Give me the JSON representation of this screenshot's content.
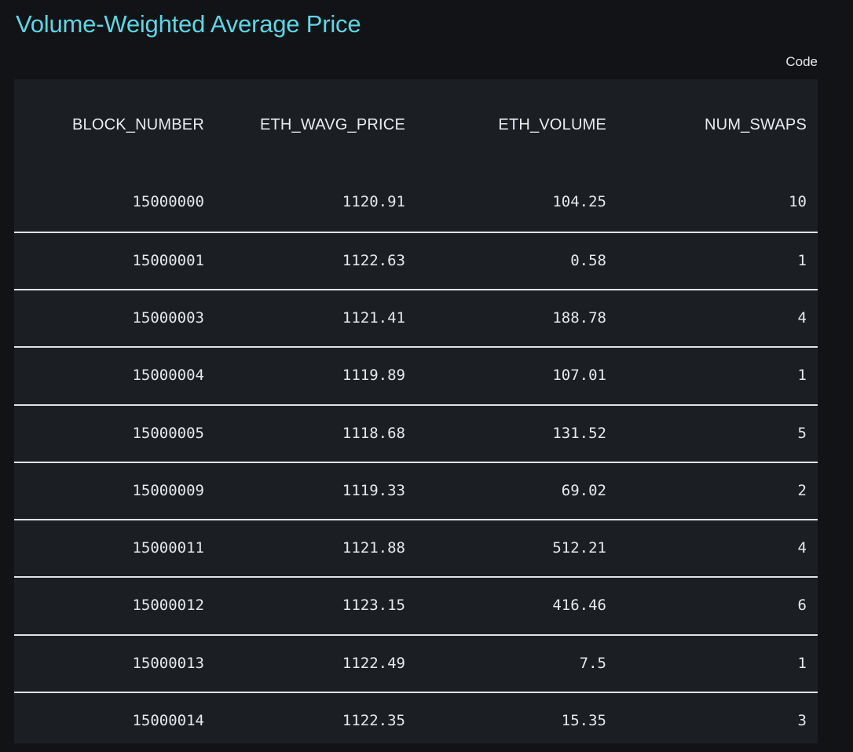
{
  "page": {
    "title": "Volume-Weighted Average Price",
    "code_label": "Code"
  },
  "colors": {
    "title": "#5fd6e3",
    "background": "#111317",
    "panel": "#1b1f24",
    "divider": "#dfe3e7",
    "text": "#e6e9ec"
  },
  "table": {
    "columns": [
      "BLOCK_NUMBER",
      "ETH_WAVG_PRICE",
      "ETH_VOLUME",
      "NUM_SWAPS"
    ],
    "rows": [
      [
        "15000000",
        "1120.91",
        "104.25",
        "10"
      ],
      [
        "15000001",
        "1122.63",
        "0.58",
        "1"
      ],
      [
        "15000003",
        "1121.41",
        "188.78",
        "4"
      ],
      [
        "15000004",
        "1119.89",
        "107.01",
        "1"
      ],
      [
        "15000005",
        "1118.68",
        "131.52",
        "5"
      ],
      [
        "15000009",
        "1119.33",
        "69.02",
        "2"
      ],
      [
        "15000011",
        "1121.88",
        "512.21",
        "4"
      ],
      [
        "15000012",
        "1123.15",
        "416.46",
        "6"
      ],
      [
        "15000013",
        "1122.49",
        "7.5",
        "1"
      ],
      [
        "15000014",
        "1122.35",
        "15.35",
        "3"
      ]
    ]
  }
}
